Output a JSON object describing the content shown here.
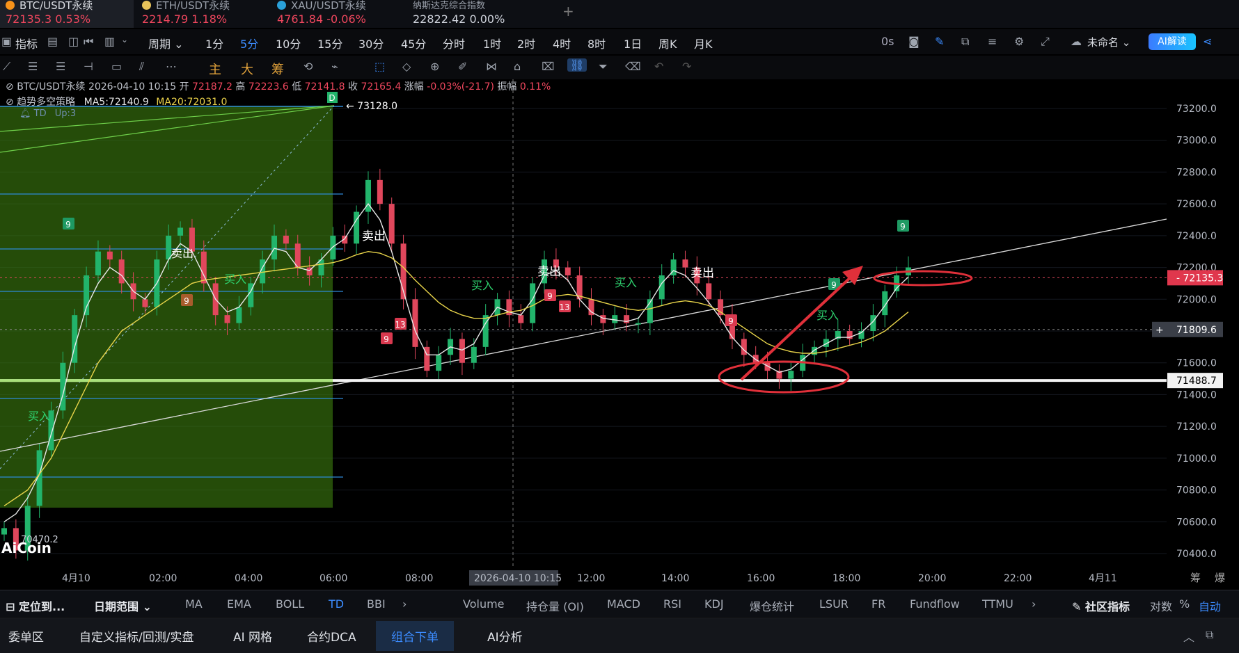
{
  "tickers": [
    {
      "name": "BTC/USDT永续",
      "price": "72135.3",
      "change": "0.53%"
    },
    {
      "name": "ETH/USDT永续",
      "price": "2214.79",
      "change": "1.18%"
    },
    {
      "name": "XAU/USDT永续",
      "price": "4761.84",
      "change": "-0.06%"
    },
    {
      "name": "纳斯达克综合指数",
      "price": "22822.42",
      "change": "0.00%"
    }
  ],
  "add_tab": "+",
  "toolbar": {
    "indicators": "指标",
    "period": "周期",
    "intervals": [
      "1分",
      "5分",
      "10分",
      "15分",
      "30分",
      "45分",
      "分时",
      "1时",
      "2时",
      "4时",
      "8时",
      "1日",
      "周K",
      "月K"
    ],
    "active_interval": "5分",
    "timer": "0s",
    "layout_name": "未命名",
    "ai_button": "AI解读"
  },
  "draw_toolbar": {
    "main": "主",
    "big": "大",
    "chips": "筹"
  },
  "legend": {
    "symbol": "BTC/USDT永续",
    "datetime": "2026-04-10 10:15",
    "open_label": "开",
    "open": "72187.2",
    "high_label": "高",
    "high": "72223.6",
    "low_label": "低",
    "low": "72141.8",
    "close_label": "收",
    "close": "72165.4",
    "change_label": "涨幅",
    "change": "-0.03%(-21.7)",
    "amp_label": "振幅",
    "amp": "0.11%",
    "strategy": "趋势多空策略",
    "ma5": "MA5:72140.9",
    "ma20": "MA20:72031.0",
    "td": "TD",
    "td_up": "Up:3"
  },
  "chart_data": {
    "type": "candlestick",
    "y_ticks": [
      "73200.0",
      "73000.0",
      "72800.0",
      "72600.0",
      "72400.0",
      "72200.0",
      "72000.0",
      "71800.0",
      "71600.0",
      "71400.0",
      "71200.0",
      "71000.0",
      "70800.0",
      "70600.0",
      "70400.0"
    ],
    "ylim": [
      70300,
      73300
    ],
    "x_ticks": [
      "4月10",
      "02:00",
      "04:00",
      "06:00",
      "08:00",
      "12:00",
      "14:00",
      "16:00",
      "18:00",
      "20:00",
      "22:00",
      "4月11"
    ],
    "crosshair_time": "2026-04-10 10:15",
    "current_price": "72135.3",
    "cursor_price": "71809.6",
    "horizontal_line_price": "71488.7",
    "annotations": {
      "high_marker": "73128.0",
      "low_marker": "70470.2",
      "sell": "卖出",
      "buy": "买入",
      "d_badge": "D",
      "td_counts": [
        "9",
        "9",
        "13",
        "9",
        "9",
        "13",
        "9",
        "9",
        "9"
      ]
    },
    "candles_close": [
      70560,
      70420,
      70700,
      71050,
      71300,
      71600,
      71900,
      72150,
      72300,
      72250,
      72100,
      72000,
      71950,
      72250,
      72400,
      72450,
      72300,
      72100,
      71900,
      71850,
      71950,
      72100,
      72250,
      72400,
      72350,
      72200,
      72150,
      72250,
      72400,
      72350,
      72550,
      72750,
      72600,
      72350,
      72000,
      71700,
      71550,
      71650,
      71750,
      71600,
      71700,
      71900,
      72000,
      71900,
      71850,
      72100,
      72250,
      72200,
      72150,
      72000,
      71900,
      71850,
      71900,
      71850,
      71850,
      72000,
      72150,
      72250,
      72200,
      72100,
      72000,
      71900,
      71750,
      71650,
      71600,
      71550,
      71500,
      71550,
      71650,
      71700,
      71750,
      71800,
      71750,
      71800,
      71900,
      72050,
      72150,
      72200
    ],
    "ma5": [
      70600,
      70650,
      70750,
      70900,
      71150,
      71400,
      71700,
      71950,
      72100,
      72200,
      72150,
      72050,
      72000,
      72100,
      72250,
      72350,
      72300,
      72150,
      72000,
      71920,
      71950,
      72050,
      72200,
      72320,
      72300,
      72200,
      72180,
      72250,
      72330,
      72380,
      72500,
      72600,
      72500,
      72300,
      72050,
      71800,
      71650,
      71650,
      71700,
      71680,
      71720,
      71850,
      71950,
      71920,
      71900,
      72000,
      72150,
      72180,
      72120,
      72000,
      71920,
      71880,
      71870,
      71860,
      71880,
      71980,
      72100,
      72180,
      72150,
      72070,
      71980,
      71880,
      71760,
      71680,
      71620,
      71580,
      71540,
      71560,
      71620,
      71680,
      71720,
      71760,
      71760,
      71790,
      71860,
      71960,
      72070,
      72140
    ],
    "ma20": [
      70700,
      70750,
      70800,
      70900,
      71000,
      71150,
      71300,
      71450,
      71600,
      71700,
      71800,
      71850,
      71900,
      71950,
      72000,
      72050,
      72100,
      72120,
      72130,
      72140,
      72150,
      72160,
      72170,
      72180,
      72190,
      72200,
      72210,
      72220,
      72230,
      72250,
      72280,
      72300,
      72290,
      72260,
      72200,
      72120,
      72050,
      71980,
      71930,
      71900,
      71880,
      71880,
      71900,
      71920,
      71930,
      71960,
      72000,
      72020,
      72030,
      72020,
      72000,
      71980,
      71960,
      71940,
      71930,
      71940,
      71960,
      71980,
      71990,
      71980,
      71960,
      71920,
      71870,
      71820,
      71770,
      71720,
      71690,
      71670,
      71660,
      71660,
      71670,
      71690,
      71710,
      71730,
      71760,
      71800,
      71860,
      71920
    ]
  },
  "indicator_bar": {
    "locate": "定位到...",
    "date_range": "日期范围",
    "main_indicators": [
      "MA",
      "EMA",
      "BOLL",
      "TD",
      "BBI"
    ],
    "active_main": "TD",
    "sub_indicators": [
      "Volume",
      "持仓量 (OI)",
      "MACD",
      "RSI",
      "KDJ",
      "爆仓统计",
      "LSUR",
      "FR",
      "Fundflow",
      "TTMU"
    ],
    "community": "社区指标",
    "log": "对数",
    "percent": "%",
    "auto": "自动"
  },
  "bottom_tabs": [
    "委单区",
    "自定义指标/回测/实盘",
    "AI 网格",
    "合约DCA",
    "组合下单",
    "AI分析"
  ],
  "active_bottom_tab": "组合下单",
  "logo": "AiCoin",
  "corner_labels": {
    "chips": "筹",
    "burst": "爆"
  }
}
